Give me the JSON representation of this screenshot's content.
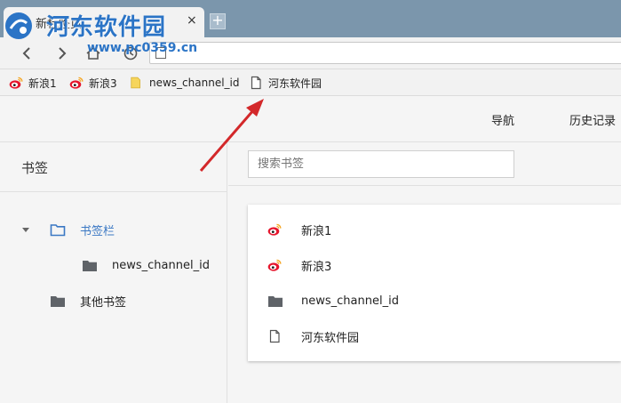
{
  "tab": {
    "title": "新标签页",
    "close": "×"
  },
  "new_tab": "+",
  "watermark": {
    "title": "河东软件园",
    "url": "www.pc0359.cn"
  },
  "bookmarks_bar": [
    {
      "label": "新浪1",
      "icon": "weibo-icon"
    },
    {
      "label": "新浪3",
      "icon": "weibo-icon"
    },
    {
      "label": "news_channel_id",
      "icon": "folder-icon"
    },
    {
      "label": "河东软件园",
      "icon": "page-icon"
    }
  ],
  "header": {
    "nav": "导航",
    "history": "历史记录"
  },
  "left": {
    "title": "书签",
    "tree": [
      {
        "label": "书签栏",
        "selected": true,
        "expanded": true
      },
      {
        "label": "news_channel_id",
        "selected": false
      },
      {
        "label": "其他书签",
        "selected": false
      }
    ]
  },
  "search": {
    "placeholder": "搜索书签"
  },
  "items": [
    {
      "label": "新浪1",
      "icon": "weibo-icon"
    },
    {
      "label": "新浪3",
      "icon": "weibo-icon"
    },
    {
      "label": "news_channel_id",
      "icon": "folder-icon"
    },
    {
      "label": "河东软件园",
      "icon": "page-icon"
    }
  ],
  "colors": {
    "accent": "#3b78c4",
    "tab_strip": "#7b96ac",
    "arrow": "#d3282a",
    "folder_open": "#3b78c4"
  }
}
